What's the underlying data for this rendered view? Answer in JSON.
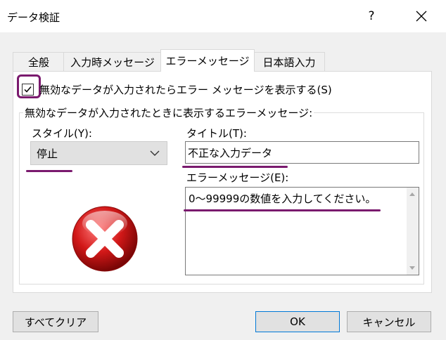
{
  "window": {
    "title": "データ検証",
    "help_label": "?"
  },
  "tabs": [
    {
      "label": "全般",
      "active": false
    },
    {
      "label": "入力時メッセージ",
      "active": false
    },
    {
      "label": "エラーメッセージ",
      "active": true
    },
    {
      "label": "日本語入力",
      "active": false
    }
  ],
  "show_error": {
    "checked": true,
    "label": "無効なデータが入力されたらエラー メッセージを表示する(S)"
  },
  "group": {
    "caption": "無効なデータが入力されたときに表示するエラーメッセージ:"
  },
  "style": {
    "label": "スタイル(Y):",
    "value": "停止",
    "icon": "error-stop-icon"
  },
  "title_field": {
    "label": "タイトル(T):",
    "value": "不正な入力データ"
  },
  "message_field": {
    "label": "エラーメッセージ(E):",
    "value": "0～99999の数値を入力してください。"
  },
  "buttons": {
    "clear_all": "すべてクリア",
    "ok": "OK",
    "cancel": "キャンセル"
  },
  "colors": {
    "annotation": "#7a1a6e",
    "error_red": "#d21818"
  }
}
